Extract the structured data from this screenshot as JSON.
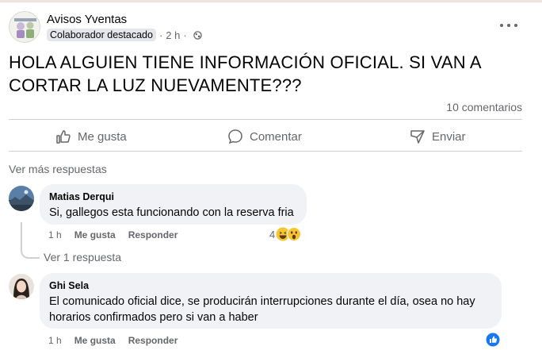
{
  "post": {
    "author": "Avisos Yventas",
    "badge": "Colaborador destacado",
    "time": "2 h",
    "text": "HOLA ALGUIEN TIENE INFORMACIÓN OFICIAL. SI VAN A CORTAR LA LUZ NUEVAMENTE???",
    "comments_count": "10 comentarios"
  },
  "actions": {
    "like": "Me gusta",
    "comment": "Comentar",
    "send": "Enviar"
  },
  "more_replies": "Ver más respuestas",
  "comments": [
    {
      "name": "Matias Derqui",
      "text": "Si, gallegos esta funcionando con la reserva fria",
      "time": "1 h",
      "like": "Me gusta",
      "reply": "Responder",
      "reactions_count": "4"
    },
    {
      "name": "Ghi Sela",
      "text": "El comunicado oficial dice, se producirán interrupciones durante el día, osea no hay horarios confirmados pero si van a haber",
      "time": "1 h",
      "like": "Me gusta",
      "reply": "Responder"
    }
  ],
  "view_one_reply": "Ver 1 respuesta",
  "colors": {
    "text": "#050505",
    "secondary": "#65676b",
    "bubble": "#f0f2f5",
    "divider": "#ced0d4",
    "like_blue": "#1877f2"
  }
}
